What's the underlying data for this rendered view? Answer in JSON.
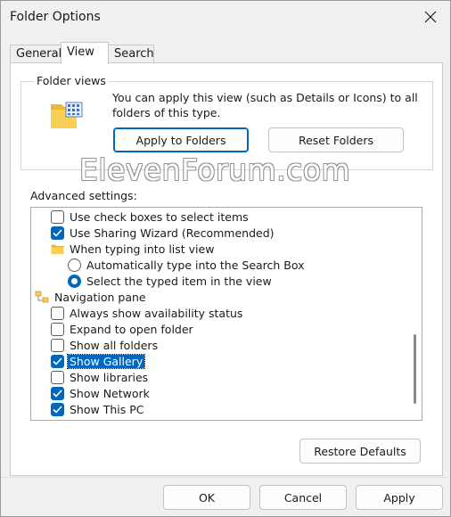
{
  "window": {
    "title": "Folder Options",
    "close_icon": "close-icon"
  },
  "tabs": [
    {
      "label": "General",
      "active": false
    },
    {
      "label": "View",
      "active": true
    },
    {
      "label": "Search",
      "active": false
    }
  ],
  "folder_views": {
    "label": "Folder views",
    "description": "You can apply this view (such as Details or Icons) to all folders of this type.",
    "apply_button": "Apply to Folders",
    "reset_button": "Reset Folders"
  },
  "watermark": "ElevenForum.com",
  "advanced": {
    "label": "Advanced settings:",
    "items": [
      {
        "type": "checkbox",
        "label": "Use check boxes to select items",
        "checked": false,
        "indent": 1
      },
      {
        "type": "checkbox",
        "label": "Use Sharing Wizard (Recommended)",
        "checked": true,
        "indent": 1
      },
      {
        "type": "folder",
        "label": "When typing into list view",
        "indent": 1
      },
      {
        "type": "radio",
        "label": "Automatically type into the Search Box",
        "checked": false,
        "indent": 2
      },
      {
        "type": "radio",
        "label": "Select the typed item in the view",
        "checked": true,
        "indent": 2
      },
      {
        "type": "nav",
        "label": "Navigation pane",
        "indent": 0
      },
      {
        "type": "checkbox",
        "label": "Always show availability status",
        "checked": false,
        "indent": 1
      },
      {
        "type": "checkbox",
        "label": "Expand to open folder",
        "checked": false,
        "indent": 1
      },
      {
        "type": "checkbox",
        "label": "Show all folders",
        "checked": false,
        "indent": 1
      },
      {
        "type": "checkbox",
        "label": "Show Gallery",
        "checked": true,
        "indent": 1,
        "selected": true
      },
      {
        "type": "checkbox",
        "label": "Show libraries",
        "checked": false,
        "indent": 1
      },
      {
        "type": "checkbox",
        "label": "Show Network",
        "checked": true,
        "indent": 1
      },
      {
        "type": "checkbox",
        "label": "Show This PC",
        "checked": true,
        "indent": 1
      }
    ]
  },
  "restore_button": "Restore Defaults",
  "footer": {
    "ok": "OK",
    "cancel": "Cancel",
    "apply": "Apply"
  },
  "colors": {
    "accent": "#0067c0",
    "folder": "#f5c542"
  }
}
